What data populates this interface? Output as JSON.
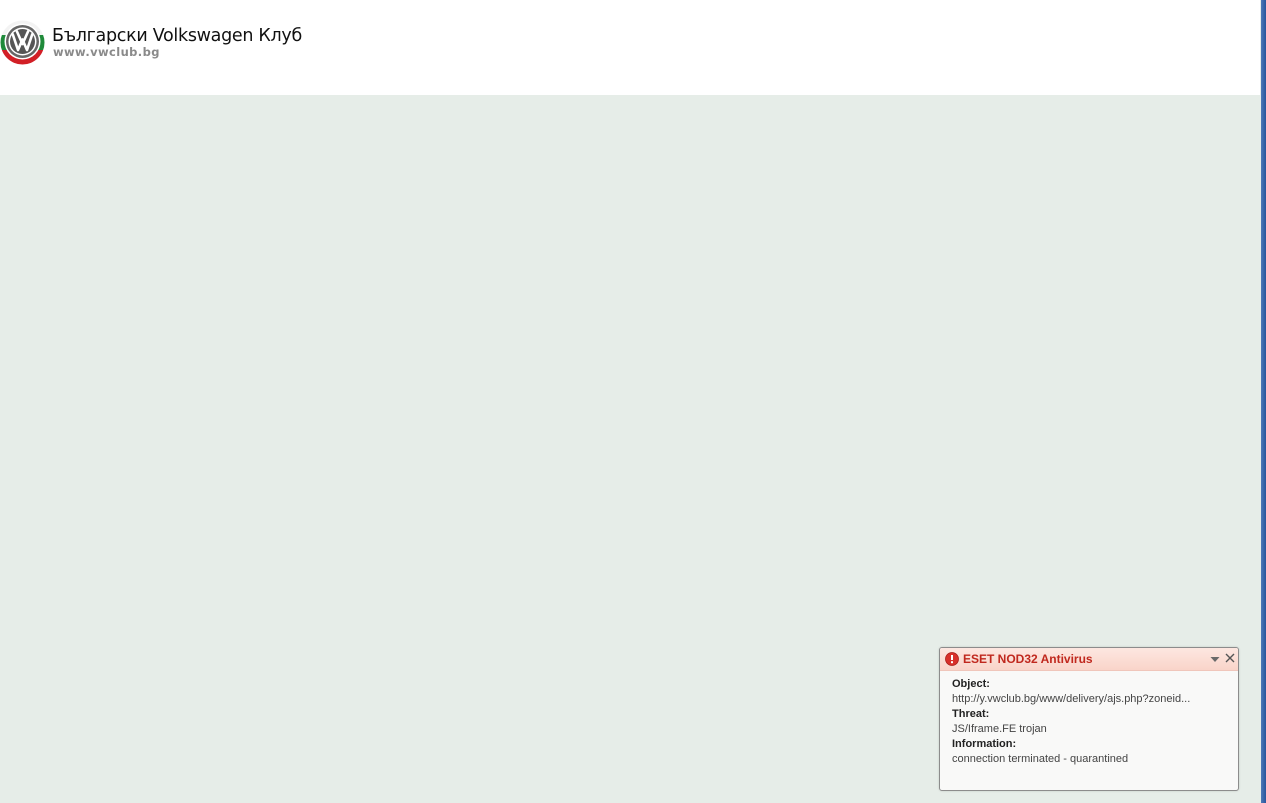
{
  "header": {
    "title": "Български Volkswagen Клуб",
    "url": "www.vwclub.bg",
    "logo_icon": "vw-logo-icon"
  },
  "colors": {
    "page_background": "#e6ede8",
    "header_background": "#ffffff",
    "alert_title": "#c0281e",
    "alert_titlebar": "#f9d4c9"
  },
  "notification": {
    "title": "ESET NOD32 Antivirus",
    "icon": "alert-icon",
    "fields": [
      {
        "label": "Object:",
        "value": "http://y.vwclub.bg/www/delivery/ajs.php?zoneid..."
      },
      {
        "label": "Threat:",
        "value": "JS/Iframe.FE trojan"
      },
      {
        "label": "Information:",
        "value": "connection terminated - quarantined"
      }
    ]
  }
}
